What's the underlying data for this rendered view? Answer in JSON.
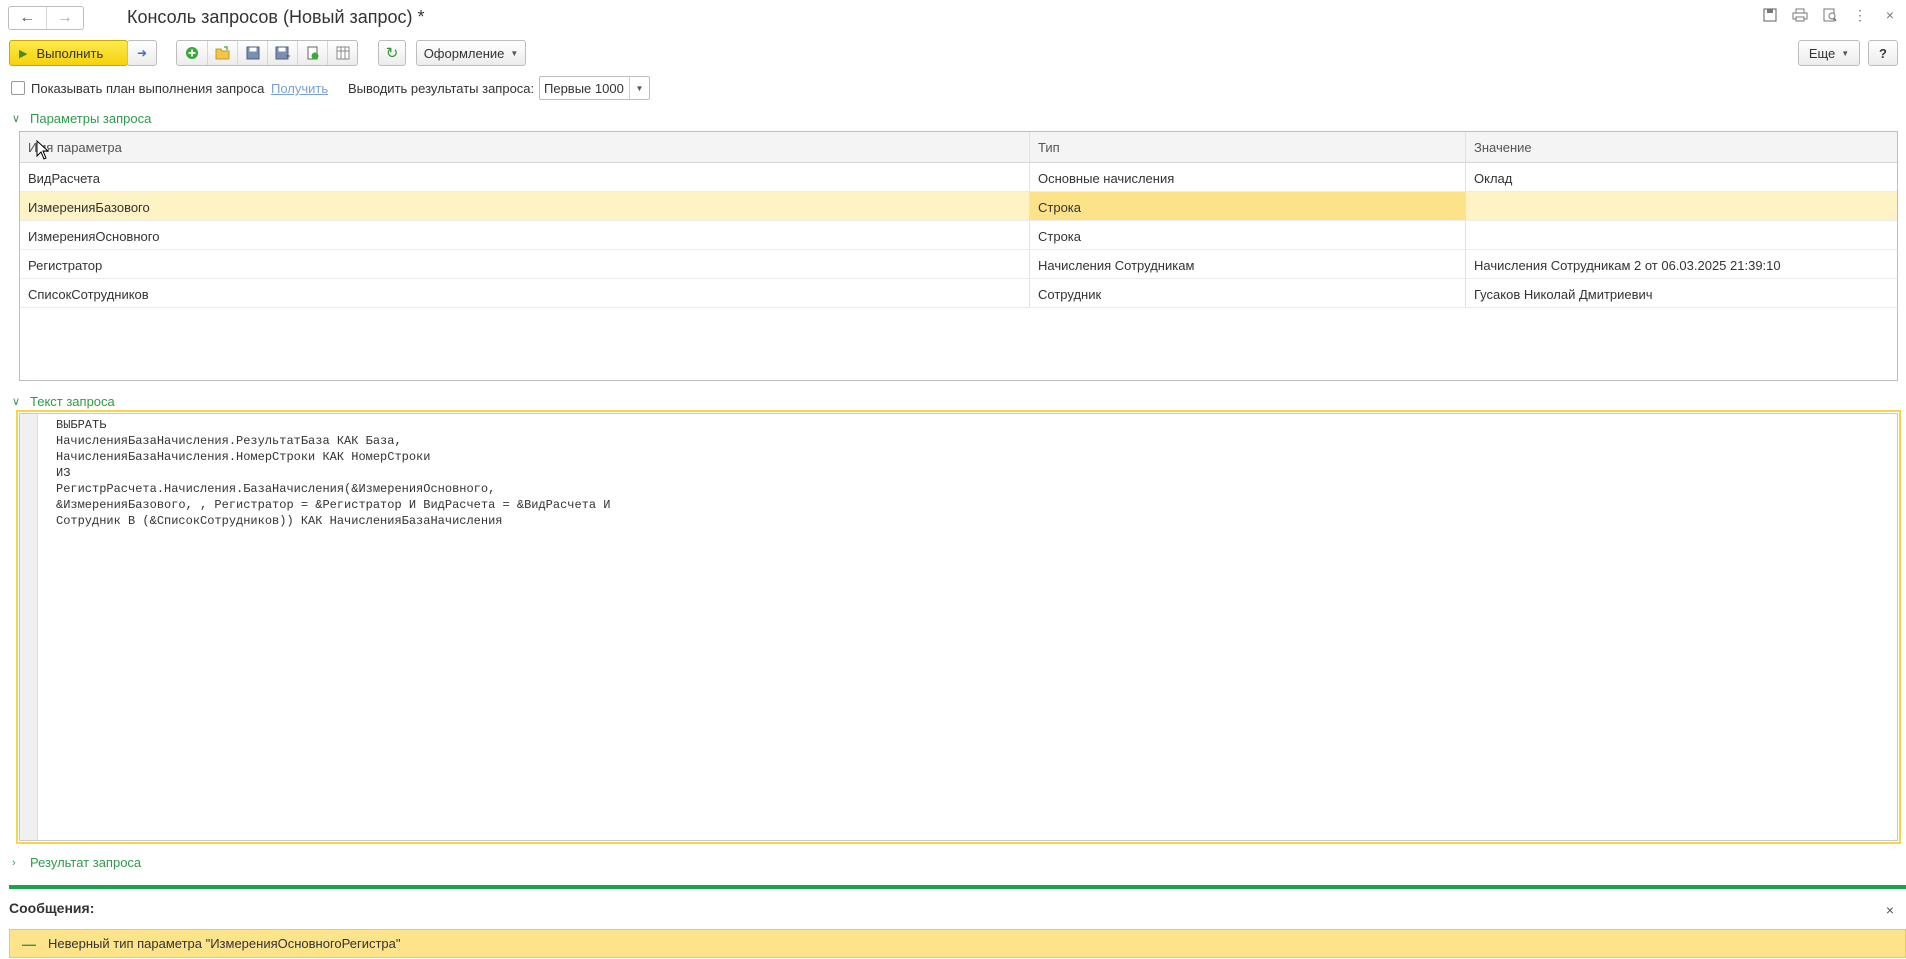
{
  "window": {
    "title": "Консоль запросов (Новый запрос) *"
  },
  "toolbar": {
    "run_label": "Выполнить",
    "format_label": "Оформление",
    "more_label": "Еще",
    "help_label": "?"
  },
  "options": {
    "show_plan_label": "Показывать план выполнения запроса",
    "get_link": "Получить",
    "output_label": "Выводить результаты запроса:",
    "output_value": "Первые 1000"
  },
  "params_section": {
    "title": "Параметры запроса",
    "columns": [
      "Имя параметра",
      "Тип",
      "Значение"
    ],
    "rows": [
      {
        "name": "ВидРасчета",
        "type": "Основные начисления",
        "value": "Оклад"
      },
      {
        "name": "ИзмеренияБазового",
        "type": "Строка",
        "value": ""
      },
      {
        "name": "ИзмеренияОсновного",
        "type": "Строка",
        "value": ""
      },
      {
        "name": "Регистратор",
        "type": "Начисления Сотрудникам",
        "value": "Начисления Сотрудникам 2 от 06.03.2025 21:39:10"
      },
      {
        "name": "СписокСотрудников",
        "type": "Сотрудник",
        "value": "Гусаков Николай Дмитриевич"
      }
    ]
  },
  "query_section": {
    "title": "Текст запроса",
    "text": "ВЫБРАТЬ\nНачисленияБазаНачисления.РезультатБаза КАК База,\nНачисленияБазаНачисления.НомерСтроки КАК НомерСтроки\nИЗ\nРегистрРасчета.Начисления.БазаНачисления(&ИзмеренияОсновного,\n&ИзмеренияБазового, , Регистратор = &Регистратор И ВидРасчета = &ВидРасчета И\nСотрудник В (&СписокСотрудников)) КАК НачисленияБазаНачисления"
  },
  "result_section": {
    "title": "Результат запроса"
  },
  "messages": {
    "title": "Сообщения:",
    "items": [
      "Неверный тип параметра \"ИзмеренияОсновногоРегистра\""
    ]
  }
}
